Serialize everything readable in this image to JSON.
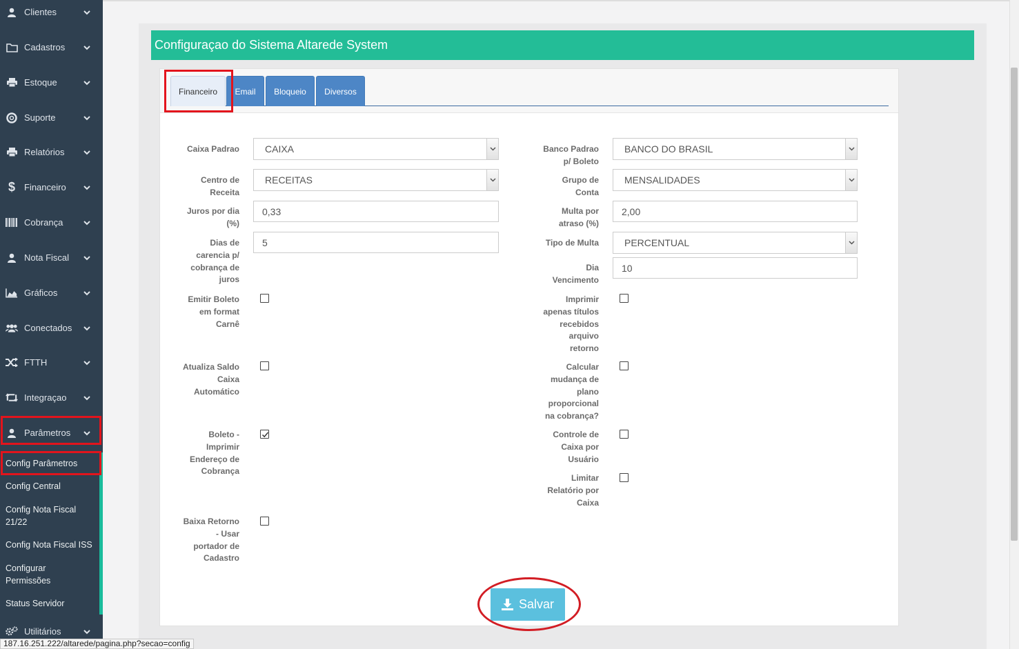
{
  "sidebar": {
    "items": [
      {
        "label": "Clientes",
        "icon": "user-icon"
      },
      {
        "label": "Cadastros",
        "icon": "folder-icon"
      },
      {
        "label": "Estoque",
        "icon": "printer-icon"
      },
      {
        "label": "Suporte",
        "icon": "lifebuoy-icon"
      },
      {
        "label": "Relatórios",
        "icon": "printer-icon"
      },
      {
        "label": "Financeiro",
        "icon": "dollar-icon"
      },
      {
        "label": "Cobrança",
        "icon": "barcode-icon"
      },
      {
        "label": "Nota Fiscal",
        "icon": "user-icon"
      },
      {
        "label": "Gráficos",
        "icon": "area-chart-icon"
      },
      {
        "label": "Conectados",
        "icon": "users-icon"
      },
      {
        "label": "FTTH",
        "icon": "shuffle-icon"
      },
      {
        "label": "Integraçao",
        "icon": "retweet-icon"
      },
      {
        "label": "Parâmetros",
        "icon": "user-icon"
      },
      {
        "label": "Utilitários",
        "icon": "gears-icon"
      }
    ],
    "submenu": [
      "Config Parâmetros",
      "Config Central",
      "Config Nota Fiscal 21/22",
      "Config Nota Fiscal ISS",
      "Configurar Permissões",
      "Status Servidor"
    ]
  },
  "page": {
    "title": "Configuraçao do Sistema Altarede System"
  },
  "tabs": [
    "Financeiro",
    "Email",
    "Bloqueio",
    "Diversos"
  ],
  "form": {
    "caixa_padrao": {
      "label": "Caixa Padrao",
      "value": "CAIXA"
    },
    "centro_receita": {
      "label": "Centro de Receita",
      "value": "RECEITAS"
    },
    "juros_dia": {
      "label": "Juros por dia (%)",
      "value": "0,33"
    },
    "dias_carencia": {
      "label": "Dias de carencia p/ cobrança de juros",
      "value": "5"
    },
    "emitir_boleto_carne": {
      "label": "Emitir Boleto em format Carnê",
      "checked": false
    },
    "atualiza_saldo": {
      "label": "Atualiza Saldo Caixa Automático",
      "checked": false
    },
    "boleto_endereco": {
      "label": "Boleto - Imprimir Endereço de Cobrança",
      "checked": true
    },
    "baixa_retorno": {
      "label": "Baixa Retorno - Usar portador de Cadastro",
      "checked": false
    },
    "banco_padrao": {
      "label": "Banco Padrao p/ Boleto",
      "value": "BANCO DO BRASIL"
    },
    "grupo_conta": {
      "label": "Grupo de Conta",
      "value": "MENSALIDADES"
    },
    "multa_atraso": {
      "label": "Multa por atraso (%)",
      "value": "2,00"
    },
    "tipo_multa": {
      "label": "Tipo de Multa",
      "value": "PERCENTUAL"
    },
    "dia_vencimento": {
      "label": "Dia Vencimento",
      "value": "10"
    },
    "imprimir_titulos": {
      "label": "Imprimir apenas títulos recebidos arquivo retorno",
      "checked": false
    },
    "calcular_mudanca": {
      "label": "Calcular mudança de plano proporcional na cobrança?",
      "checked": false
    },
    "controle_caixa": {
      "label": "Controle de Caixa por Usuário",
      "checked": false
    },
    "limitar_relatorio": {
      "label": "Limitar Relatório por Caixa",
      "checked": false
    }
  },
  "save_label": "Salvar",
  "status_url": "187.16.251.222/altarede/pagina.php?secao=config",
  "colors": {
    "sidebar": "#2f4050",
    "header": "#23bd97",
    "tab": "#4d86c6",
    "save": "#5bc0de",
    "highlight": "#e3141c"
  }
}
